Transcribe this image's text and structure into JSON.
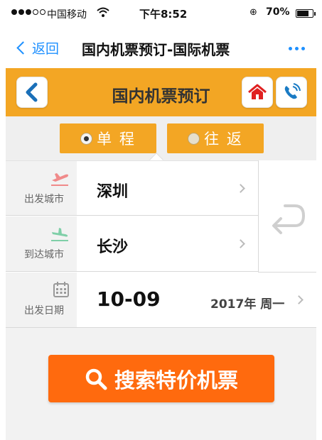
{
  "status_bar": {
    "carrier": "中国移动",
    "time": "下午8:52",
    "battery": "70%"
  },
  "nav": {
    "back_label": "返回",
    "title": "国内机票预订-国际机票"
  },
  "header": {
    "title": "国内机票预订"
  },
  "trip_type": {
    "oneway_label": "单 程",
    "roundtrip_label": "往 返",
    "selected": "oneway"
  },
  "form": {
    "departure": {
      "label": "出发城市",
      "value": "深圳"
    },
    "arrival": {
      "label": "到达城市",
      "value": "长沙"
    },
    "date": {
      "label": "出发日期",
      "value": "10-09",
      "year_weekday": "2017年 周一"
    }
  },
  "search": {
    "button_label": "搜索特价机票"
  },
  "icons": {
    "back": "chevron-left-icon",
    "home": "home-icon",
    "phone": "phone-icon",
    "takeoff": "airplane-takeoff-icon",
    "landing": "airplane-landing-icon",
    "calendar": "calendar-icon",
    "swap": "swap-icon",
    "search": "search-icon"
  },
  "colors": {
    "header_bg": "#f3a624",
    "search_button": "#ff6a0e",
    "link_blue": "#1e90ff"
  }
}
